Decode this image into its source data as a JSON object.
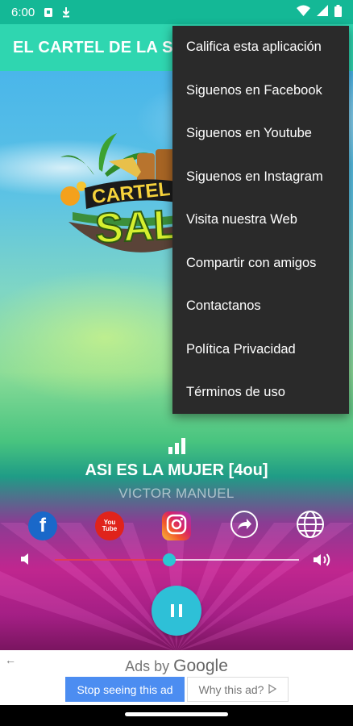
{
  "status_bar": {
    "time": "6:00",
    "icons_left": [
      "sim-card-icon",
      "download-icon"
    ],
    "icons_right": [
      "wifi-icon",
      "signal-icon",
      "battery-icon"
    ]
  },
  "app_bar": {
    "title": "EL CARTEL DE LA SALSA"
  },
  "logo": {
    "text_line1": "CARTEL",
    "text_line2": "SAL"
  },
  "now_playing": {
    "title": "ASI ES LA MUJER [4ou]",
    "artist": "VICTOR MANUEL",
    "icon": "equalizer-icon"
  },
  "social_buttons": [
    {
      "name": "facebook",
      "icon": "facebook-icon",
      "glyph": "f"
    },
    {
      "name": "youtube",
      "icon": "youtube-icon",
      "glyph": "You Tube"
    },
    {
      "name": "instagram",
      "icon": "instagram-icon"
    },
    {
      "name": "share",
      "icon": "share-icon"
    },
    {
      "name": "web",
      "icon": "globe-icon"
    }
  ],
  "volume": {
    "level": 0.47
  },
  "player": {
    "state": "playing",
    "button_icon": "pause-icon"
  },
  "ad": {
    "ads_by": "Ads by",
    "google": "Google",
    "stop_label": "Stop seeing this ad",
    "why_label": "Why this ad?"
  },
  "overflow_menu": {
    "items": [
      "Califica esta aplicación",
      "Siguenos en Facebook",
      "Siguenos en Youtube",
      "Siguenos en Instagram",
      "Visita nuestra Web",
      "Compartir con amigos",
      "Contactanos",
      "Política Privacidad",
      "Términos de uso"
    ]
  },
  "colors": {
    "status_bar": "#14b896",
    "app_bar": "#2fd6b0",
    "menu_bg": "#2a2a2a",
    "accent": "#2ec0d7",
    "progress_fill": "#e23b55",
    "ad_button": "#4c8df1"
  }
}
